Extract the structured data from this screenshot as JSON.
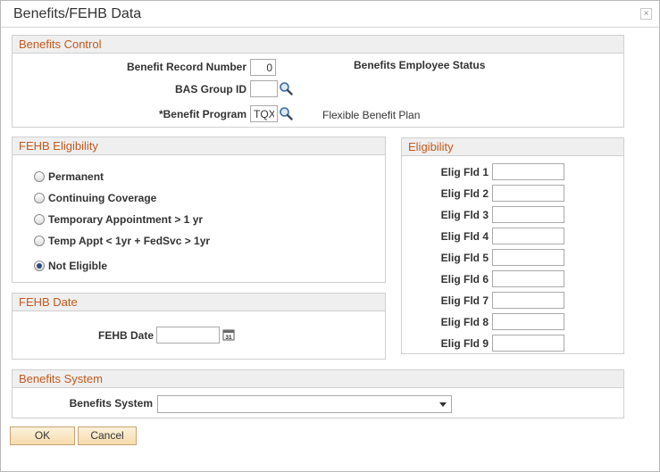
{
  "dialog": {
    "title": "Benefits/FEHB Data",
    "close_glyph": "×"
  },
  "benefits_control": {
    "header": "Benefits Control",
    "benefit_record_number_label": "Benefit Record Number",
    "benefit_record_number_value": "0",
    "bas_group_id_label": "BAS Group ID",
    "bas_group_id_value": "",
    "benefit_program_label": "*Benefit Program",
    "benefit_program_value": "TQX",
    "benefit_program_desc": "Flexible Benefit Plan",
    "employee_status_label": "Benefits Employee Status"
  },
  "fehb_eligibility": {
    "header": "FEHB Eligibility",
    "options": [
      {
        "label": "Permanent",
        "checked": false
      },
      {
        "label": "Continuing Coverage",
        "checked": false
      },
      {
        "label": "Temporary Appointment > 1 yr",
        "checked": false
      },
      {
        "label": "Temp Appt < 1yr + FedSvc > 1yr",
        "checked": false
      },
      {
        "label": "Not Eligible",
        "checked": true
      }
    ]
  },
  "fehb_date": {
    "header": "FEHB Date",
    "label": "FEHB Date",
    "value": ""
  },
  "eligibility": {
    "header": "Eligibility",
    "fields": [
      {
        "label": "Elig Fld 1",
        "value": ""
      },
      {
        "label": "Elig Fld 2",
        "value": ""
      },
      {
        "label": "Elig Fld 3",
        "value": ""
      },
      {
        "label": "Elig Fld 4",
        "value": ""
      },
      {
        "label": "Elig Fld 5",
        "value": ""
      },
      {
        "label": "Elig Fld 6",
        "value": ""
      },
      {
        "label": "Elig Fld 7",
        "value": ""
      },
      {
        "label": "Elig Fld 8",
        "value": ""
      },
      {
        "label": "Elig Fld 9",
        "value": ""
      }
    ]
  },
  "benefits_system": {
    "header": "Benefits System",
    "label": "Benefits System",
    "selected": ""
  },
  "buttons": {
    "ok": "OK",
    "cancel": "Cancel"
  },
  "colors": {
    "section_header_text": "#c15a1f",
    "button_fill": "#f6dcae"
  }
}
